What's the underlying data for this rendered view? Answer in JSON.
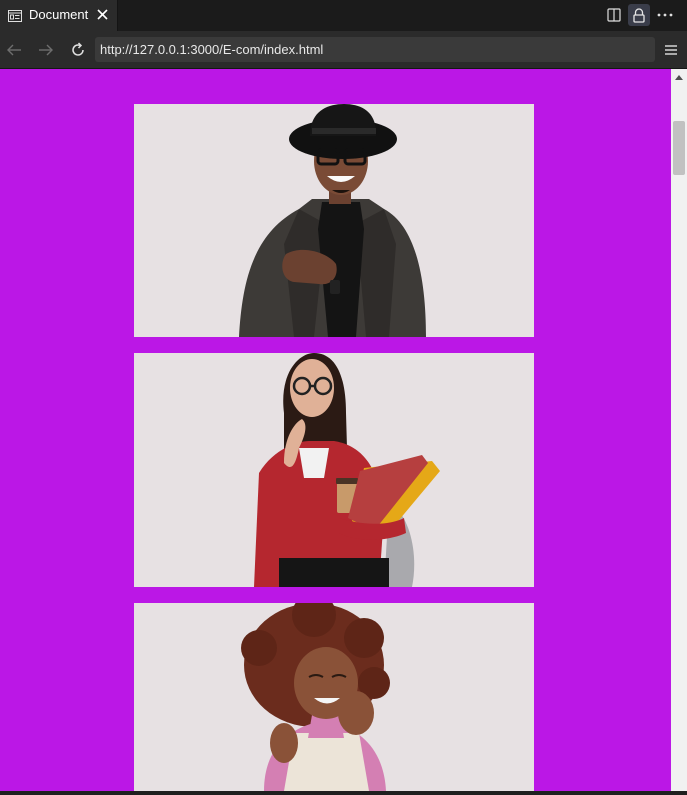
{
  "browser": {
    "tab": {
      "title": "Document",
      "icon": "document-icon",
      "close_icon": "close-icon"
    },
    "window_buttons": [
      "split-view-icon",
      "lock-icon",
      "more-icon"
    ],
    "nav": {
      "back_icon": "back-arrow-icon",
      "forward_icon": "forward-arrow-icon",
      "reload_icon": "reload-icon",
      "url": "http://127.0.0.1:3000/E-com/index.html",
      "menu_icon": "hamburger-menu-icon"
    }
  },
  "page": {
    "background_color": "#bb17e6",
    "cards": [
      {
        "subject": "man-in-hat-photo",
        "background": "#e7e1e3"
      },
      {
        "subject": "woman-with-folders-photo",
        "background": "#e7e1e3"
      },
      {
        "subject": "woman-curly-hair-photo",
        "background": "#e7e1e3"
      }
    ]
  },
  "scrollbar": {
    "up_icon": "scroll-up-arrow-icon"
  }
}
